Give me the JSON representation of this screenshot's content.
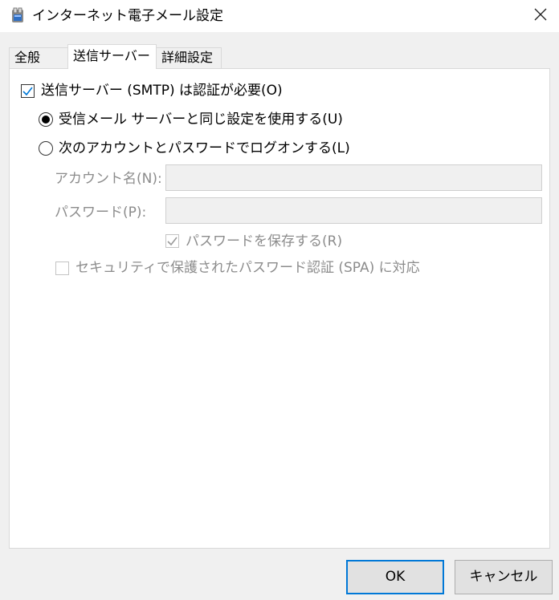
{
  "window": {
    "title": "インターネット電子メール設定",
    "app_icon": "outlook-settings-icon",
    "close_icon": "close-icon"
  },
  "tabs": [
    {
      "label": "全般",
      "active": false
    },
    {
      "label": "送信サーバー",
      "active": true
    },
    {
      "label": "詳細設定",
      "active": false
    }
  ],
  "outgoing": {
    "smtp_auth_label": "送信サーバー (SMTP) は認証が必要(O)",
    "smtp_auth_checked": true,
    "radio_same_label": "受信メール サーバーと同じ設定を使用する(U)",
    "radio_same_selected": true,
    "radio_logon_label": "次のアカウントとパスワードでログオンする(L)",
    "radio_logon_selected": false,
    "account_label": "アカウント名(N):",
    "account_value": "",
    "password_label": "パスワード(P):",
    "password_value": "",
    "save_password_label": "パスワードを保存する(R)",
    "save_password_checked": true,
    "spa_label": "セキュリティで保護されたパスワード認証 (SPA) に対応"
  },
  "buttons": {
    "ok": "OK",
    "cancel": "キャンセル"
  },
  "colors": {
    "accent": "#0078d7",
    "disabled_text": "#8c8c8c"
  }
}
